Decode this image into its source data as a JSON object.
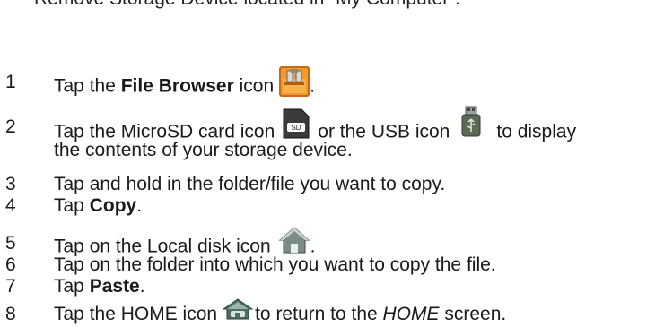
{
  "header": "Remove Storage Device located in “My Computer”.",
  "steps": [
    {
      "num": "1",
      "pre": "Tap the ",
      "bold": "File Browser",
      "post": " icon",
      "end": "."
    },
    {
      "num": "2",
      "pre": "Tap the MicroSD card icon",
      "mid": "or the USB icon",
      "post": "to display",
      "line2": "the contents of your storage device.",
      "sd_label": "SD"
    },
    {
      "num": "3",
      "text": "Tap and hold in the folder/file you want to copy."
    },
    {
      "num": "4",
      "pre": "Tap ",
      "bold": "Copy",
      "end": "."
    },
    {
      "num": "5",
      "pre": "Tap on the Local disk icon",
      "end": "."
    },
    {
      "num": "6",
      "text": "Tap on the folder into which you want to copy the file."
    },
    {
      "num": "7",
      "pre": "Tap ",
      "bold": "Paste",
      "end": "."
    },
    {
      "num": "8",
      "pre": "Tap the HOME icon",
      "post": "to return to the ",
      "italic": "HOME",
      "end": " screen."
    }
  ],
  "icons": {
    "file_browser": "file-browser-icon",
    "microsd": "microsd-card-icon",
    "usb": "usb-icon",
    "local_disk": "local-disk-icon",
    "home": "home-icon"
  }
}
